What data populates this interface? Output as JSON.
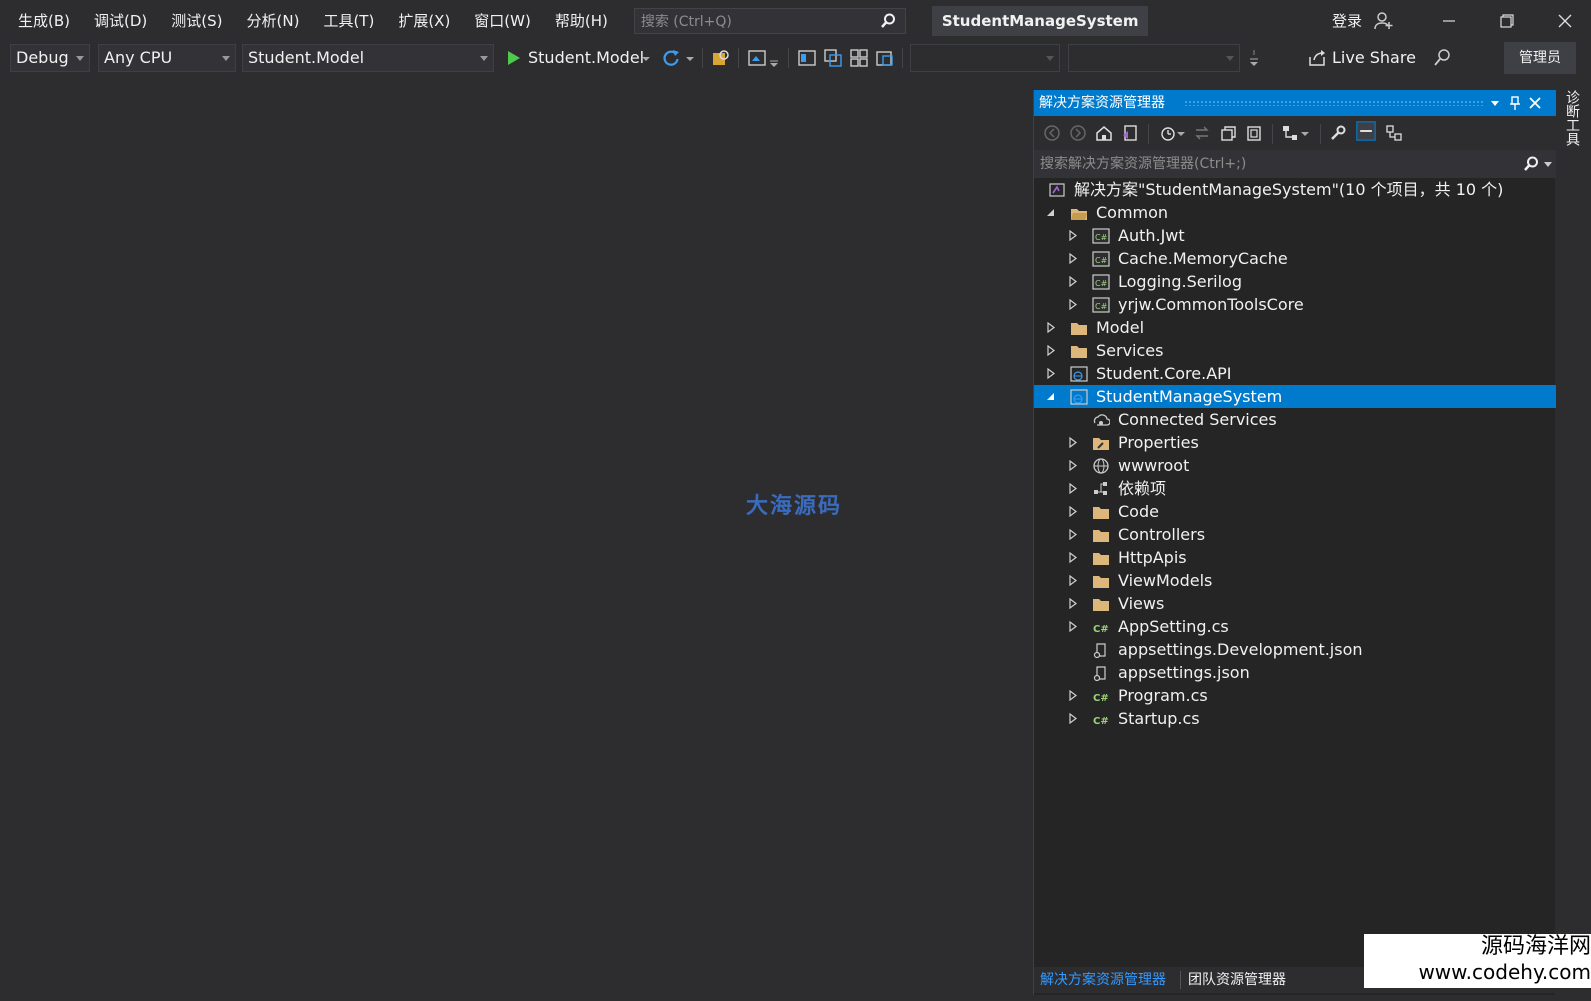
{
  "menu": {
    "items": [
      "生成(B)",
      "调试(D)",
      "测试(S)",
      "分析(N)",
      "工具(T)",
      "扩展(X)",
      "窗口(W)",
      "帮助(H)"
    ],
    "search_placeholder": "搜索 (Ctrl+Q)",
    "solution_name": "StudentManageSystem",
    "login": "登录"
  },
  "toolbar": {
    "config": "Debug",
    "platform": "Any CPU",
    "startup_project": "Student.Model",
    "run_label": "Student.Model",
    "live_share": "Live Share",
    "admin": "管理员"
  },
  "editor": {
    "watermark": "大海源码"
  },
  "side_tab": "诊断工具",
  "solution_explorer": {
    "title": "解决方案资源管理器",
    "search_placeholder": "搜索解决方案资源管理器(Ctrl+;)",
    "tree": [
      {
        "label": "解决方案\"StudentManageSystem\"(10 个项目，共 10 个)",
        "level": 0,
        "expander": "none",
        "icon": "solution-icon"
      },
      {
        "label": "Common",
        "level": 1,
        "expander": "expanded",
        "icon": "folder-open-icon"
      },
      {
        "label": "Auth.Jwt",
        "level": 2,
        "expander": "collapsed",
        "icon": "csharp-project-icon"
      },
      {
        "label": "Cache.MemoryCache",
        "level": 2,
        "expander": "collapsed",
        "icon": "csharp-project-icon"
      },
      {
        "label": "Logging.Serilog",
        "level": 2,
        "expander": "collapsed",
        "icon": "csharp-project-icon"
      },
      {
        "label": "yrjw.CommonToolsCore",
        "level": 2,
        "expander": "collapsed",
        "icon": "csharp-project-icon"
      },
      {
        "label": "Model",
        "level": 1,
        "expander": "collapsed",
        "icon": "folder-icon"
      },
      {
        "label": "Services",
        "level": 1,
        "expander": "collapsed",
        "icon": "folder-icon"
      },
      {
        "label": "Student.Core.API",
        "level": 1,
        "expander": "collapsed",
        "icon": "web-project-icon"
      },
      {
        "label": "StudentManageSystem",
        "level": 1,
        "expander": "expanded",
        "icon": "web-project-icon",
        "selected": true
      },
      {
        "label": "Connected Services",
        "level": 2,
        "expander": "none",
        "icon": "connected-services-icon"
      },
      {
        "label": "Properties",
        "level": 2,
        "expander": "collapsed",
        "icon": "properties-icon"
      },
      {
        "label": "wwwroot",
        "level": 2,
        "expander": "collapsed",
        "icon": "globe-icon"
      },
      {
        "label": "依赖项",
        "level": 2,
        "expander": "collapsed",
        "icon": "dependencies-icon"
      },
      {
        "label": "Code",
        "level": 2,
        "expander": "collapsed",
        "icon": "folder-icon"
      },
      {
        "label": "Controllers",
        "level": 2,
        "expander": "collapsed",
        "icon": "folder-icon"
      },
      {
        "label": "HttpApis",
        "level": 2,
        "expander": "collapsed",
        "icon": "folder-icon"
      },
      {
        "label": "ViewModels",
        "level": 2,
        "expander": "collapsed",
        "icon": "folder-icon"
      },
      {
        "label": "Views",
        "level": 2,
        "expander": "collapsed",
        "icon": "folder-icon"
      },
      {
        "label": "AppSetting.cs",
        "level": 2,
        "expander": "collapsed",
        "icon": "csharp-file-icon"
      },
      {
        "label": "appsettings.Development.json",
        "level": 2,
        "expander": "none",
        "icon": "json-file-icon"
      },
      {
        "label": "appsettings.json",
        "level": 2,
        "expander": "none",
        "icon": "json-file-icon"
      },
      {
        "label": "Program.cs",
        "level": 2,
        "expander": "collapsed",
        "icon": "csharp-file-icon"
      },
      {
        "label": "Startup.cs",
        "level": 2,
        "expander": "collapsed",
        "icon": "csharp-file-icon"
      }
    ],
    "bottom_tabs": [
      "解决方案资源管理器",
      "团队资源管理器"
    ]
  },
  "watermark_br": {
    "line1": "源码海洋网",
    "line2": "www.codehy.com"
  },
  "colors": {
    "accent": "#007acc",
    "background": "#2d2d30",
    "panel": "#252526"
  }
}
